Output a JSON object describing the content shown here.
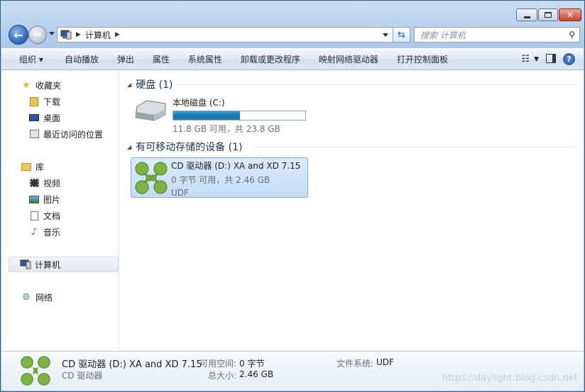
{
  "address": {
    "path": "计算机"
  },
  "search": {
    "placeholder": "搜索 计算机"
  },
  "toolbar": [
    "组织 ▾",
    "自动播放",
    "弹出",
    "属性",
    "系统属性",
    "卸载或更改程序",
    "映射网络驱动器",
    "打开控制面板"
  ],
  "nav": {
    "favorites": "收藏夹",
    "downloads": "下载",
    "desktop": "桌面",
    "recent": "最近访问的位置",
    "libraries": "库",
    "videos": "视频",
    "pictures": "图片",
    "documents": "文档",
    "music": "音乐",
    "computer": "计算机",
    "network": "网络"
  },
  "groups": {
    "hdd": "硬盘 (1)",
    "removable": "有可移动存储的设备 (1)"
  },
  "local_disk": {
    "name": "本地磁盘 (C:)",
    "space": "11.8 GB 可用，共 23.8 GB",
    "used_fraction": 0.504
  },
  "cd_drive": {
    "name": "CD 驱动器 (D:) XA and XD 7.15",
    "space": "0 字节 可用，共 2.46 GB",
    "fs": "UDF"
  },
  "status": {
    "title": "CD 驱动器 (D:) XA and XD 7.15",
    "type": "CD 驱动器",
    "free_label": "可用空间:",
    "free_value": "0 字节",
    "total_label": "总大小:",
    "total_value": "2.46 GB",
    "fs_label": "文件系统:",
    "fs_value": "UDF"
  },
  "watermark": "https://daylight.blog.csdn.net"
}
